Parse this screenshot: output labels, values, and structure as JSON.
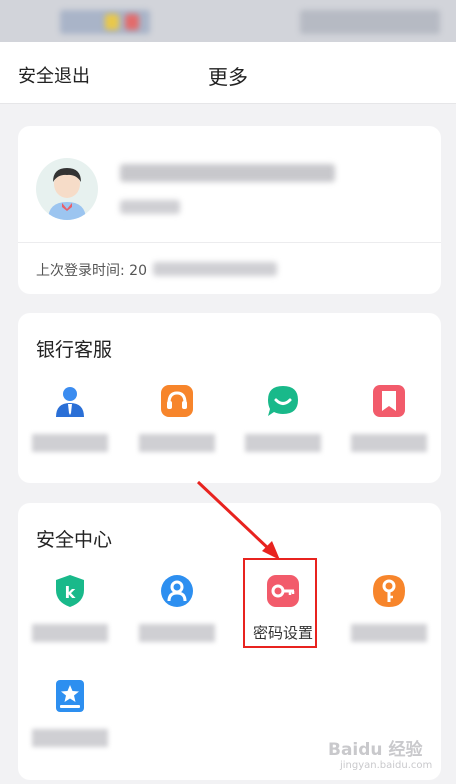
{
  "header": {
    "logout_label": "安全退出",
    "title": "更多"
  },
  "profile": {
    "last_login_label": "上次登录时间:",
    "last_login_value": "20"
  },
  "bank_service": {
    "title": "银行客服",
    "items": [
      {
        "icon": "agent-icon",
        "label": ""
      },
      {
        "icon": "headset-icon",
        "label": ""
      },
      {
        "icon": "chat-icon",
        "label": ""
      },
      {
        "icon": "bookmark-icon",
        "label": ""
      }
    ]
  },
  "security_center": {
    "title": "安全中心",
    "items": [
      {
        "icon": "shield-k-icon",
        "label": ""
      },
      {
        "icon": "user-badge-icon",
        "label": ""
      },
      {
        "icon": "key-icon",
        "label": "密码设置"
      },
      {
        "icon": "lock-key-icon",
        "label": ""
      },
      {
        "icon": "star-book-icon",
        "label": ""
      }
    ]
  },
  "watermark": {
    "brand": "Baidu 经验",
    "url": "jingyan.baidu.com"
  },
  "colors": {
    "highlight": "#e8231f",
    "blue": "#2d8ff0",
    "orange": "#f7852b",
    "green": "#19b98a",
    "red": "#f25b6b"
  }
}
